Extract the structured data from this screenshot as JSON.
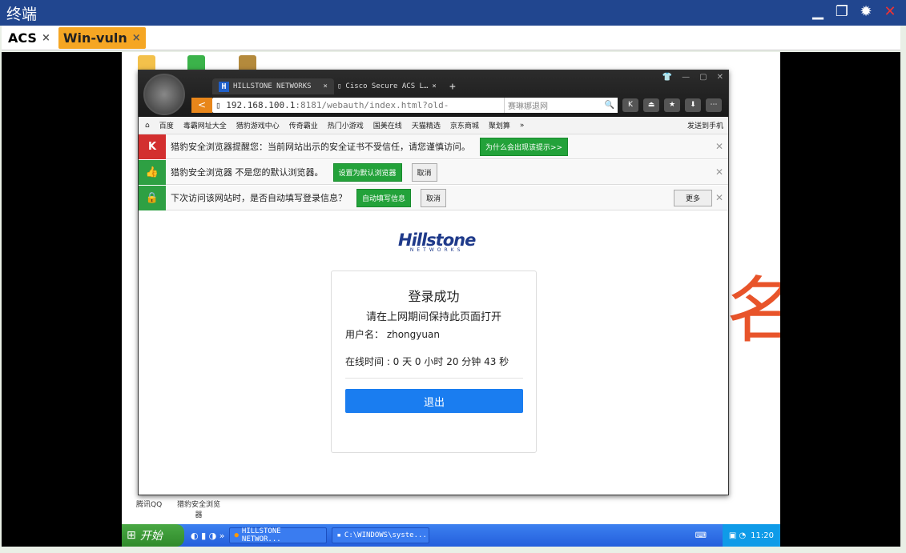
{
  "window": {
    "title": "终端",
    "controls": [
      "minimize-icon",
      "restore-icon",
      "gear-icon",
      "close-icon"
    ]
  },
  "tabs": [
    {
      "label": "ACS",
      "close": "×",
      "active": false
    },
    {
      "label": "Win-vuln",
      "close": "×",
      "active": true
    }
  ],
  "browser": {
    "tabs": [
      {
        "label": "HILLSTONE NETWORKS",
        "icon": "H",
        "close": "×"
      },
      {
        "label": "Cisco Secure ACS L…",
        "close": "×"
      }
    ],
    "new_tab": "+",
    "back": "<",
    "address_host": "192.168.100.1",
    "address_rest": ":8181/webauth/index.html?old-",
    "search_placeholder": "赛琳娜退网",
    "toolbar_icons": [
      "K",
      "⏏",
      "★",
      "⬇",
      "⋯"
    ],
    "bookmarks": [
      "百度",
      "毒霸网址大全",
      "猎豹游戏中心",
      "传奇霸业",
      "热门小游戏",
      "国美在线",
      "天猫精选",
      "京东商城",
      "聚划算"
    ],
    "bookmarks_more": "»",
    "send_to_phone": "发送到手机",
    "notices": [
      {
        "text": "猎豹安全浏览器提醒您：当前网站出示的安全证书不受信任，请您谨慎访问。",
        "button": "为什么会出现该提示>>",
        "color": "#d32f2f",
        "icon": "K"
      },
      {
        "text": "猎豹安全浏览器 不是您的默认浏览器。",
        "button": "设置为默认浏览器",
        "secondary": "取消",
        "color": "#2ea043",
        "icon": "👍"
      },
      {
        "text": "下次访问该网站时，是否自动填写登录信息？",
        "button": "自动填写信息",
        "secondary": "取消",
        "more": "更多",
        "color": "#2ea043",
        "icon": "🔒"
      }
    ]
  },
  "page": {
    "logo_name": "Hillstone",
    "logo_sub": "NETWORKS",
    "title": "登录成功",
    "keep_open": "请在上网期间保持此页面打开",
    "username_line": "用户名： zhongyuan",
    "online_time": "在线时间 : 0 天 0 小时 20 分钟 43 秒",
    "logout": "退出"
  },
  "desktop": {
    "big_text": "名",
    "labels": [
      "腾讯QQ",
      "猎豹安全浏览器"
    ]
  },
  "taskbar": {
    "start": "开始",
    "tasks": [
      "HILLSTONE NETWOR...",
      "C:\\WINDOWS\\syste..."
    ],
    "clock": "11:20"
  }
}
